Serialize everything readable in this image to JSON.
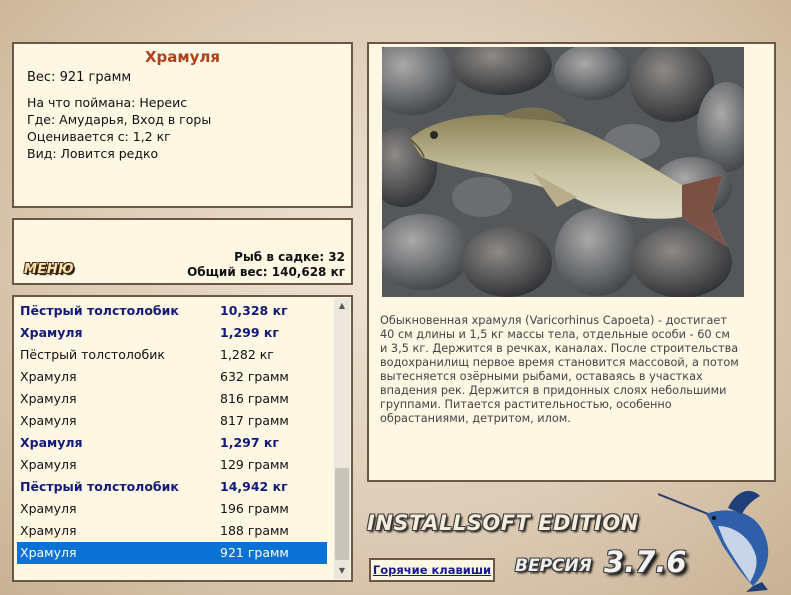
{
  "catch": {
    "title": "Храмуля",
    "weight": "Вес: 921 грамм",
    "bait": "На что поймана: Нереис",
    "place": "Где: Амударья, Вход в горы",
    "value": "Оценивается с: 1,2 кг",
    "rarity": "Вид: Ловится редко"
  },
  "stats": {
    "menu_label": "МЕНЮ",
    "fish_count": "Рыб в садке: 32",
    "total_weight": "Общий вес: 140,628 кг"
  },
  "fish_list": [
    {
      "name": "Пёстрый толстолобик",
      "weight": "10,328 кг",
      "big": true
    },
    {
      "name": "Храмуля",
      "weight": "1,299 кг",
      "big": true
    },
    {
      "name": "Пёстрый толстолобик",
      "weight": "1,282 кг",
      "big": false
    },
    {
      "name": "Храмуля",
      "weight": "632 грамм",
      "big": false
    },
    {
      "name": "Храмуля",
      "weight": "816 грамм",
      "big": false
    },
    {
      "name": "Храмуля",
      "weight": "817 грамм",
      "big": false
    },
    {
      "name": "Храмуля",
      "weight": "1,297 кг",
      "big": true
    },
    {
      "name": "Храмуля",
      "weight": "129 грамм",
      "big": false
    },
    {
      "name": "Пёстрый толстолобик",
      "weight": "14,942 кг",
      "big": true
    },
    {
      "name": "Храмуля",
      "weight": "196 грамм",
      "big": false
    },
    {
      "name": "Храмуля",
      "weight": "188 грамм",
      "big": false
    },
    {
      "name": "Храмуля",
      "weight": "921 грамм",
      "big": false,
      "selected": true
    }
  ],
  "description": "Обыкновенная храмуля (Varicorhinus Capoeta) - достигает 40 см длины и 1,5 кг массы тела, отдельные особи - 60 см и 3,5 кг. Держится в речках, каналах. После строительства водохранилищ первое время становится массовой, а потом вытесняется озёрными рыбами, оставаясь в участках впадения рек. Держится в придонных слоях небольшими группами. Питается растительностью, особенно обрастаниями, детритом, илом.",
  "branding": {
    "edition": "INSTALLSOFT EDITION",
    "version_label": "ВЕРСИЯ",
    "version_number": "3.7.6"
  },
  "hotkeys_label": "Горячие клавиши",
  "colors": {
    "panel_bg": "#fdf7e3",
    "panel_border": "#6a5845",
    "title": "#b0401a",
    "big_fish": "#131a78",
    "selection": "#0a72d4"
  }
}
